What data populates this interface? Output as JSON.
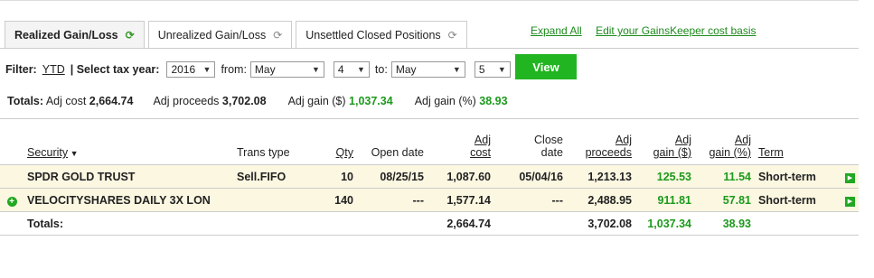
{
  "tabs": [
    {
      "label": "Realized Gain/Loss",
      "icon": "refresh-icon"
    },
    {
      "label": "Unrealized Gain/Loss",
      "icon": "refresh-icon"
    },
    {
      "label": "Unsettled Closed Positions",
      "icon": "refresh-icon"
    }
  ],
  "links": {
    "expand_all": "Expand All",
    "edit_cost_basis": "Edit your GainsKeeper cost basis"
  },
  "filter": {
    "label": "Filter:",
    "ytd": "YTD",
    "tax_year_label": "| Select tax year:",
    "tax_year": "2016",
    "from_label": "from:",
    "from_month": "May",
    "from_day": "4",
    "to_label": "to:",
    "to_month": "May",
    "to_day": "5",
    "view_button": "View"
  },
  "totals": {
    "label": "Totals:",
    "adj_cost_label": "Adj cost",
    "adj_cost": "2,664.74",
    "adj_proceeds_label": "Adj proceeds",
    "adj_proceeds": "3,702.08",
    "adj_gain_label": "Adj gain ($)",
    "adj_gain": "1,037.34",
    "adj_gain_pct_label": "Adj gain (%)",
    "adj_gain_pct": "38.93"
  },
  "table": {
    "headers": {
      "security": "Security",
      "trans_type": "Trans type",
      "qty": "Qty",
      "open_date": "Open date",
      "adj_cost_1": "Adj",
      "adj_cost_2": "cost",
      "close_date_1": "Close",
      "close_date_2": "date",
      "adj_proceeds_1": "Adj",
      "adj_proceeds_2": "proceeds",
      "adj_gain_1": "Adj",
      "adj_gain_2": "gain ($)",
      "adj_gain_pct_1": "Adj",
      "adj_gain_pct_2": "gain (%)",
      "term": "Term"
    },
    "rows": [
      {
        "security": "SPDR GOLD TRUST",
        "trans_type": "Sell.FIFO",
        "qty": "10",
        "open_date": "08/25/15",
        "adj_cost": "1,087.60",
        "close_date": "05/04/16",
        "adj_proceeds": "1,213.13",
        "adj_gain": "125.53",
        "adj_gain_pct": "11.54",
        "term": "Short-term"
      },
      {
        "security": "VELOCITYSHARES DAILY 3X LON",
        "trans_type": "",
        "qty": "140",
        "open_date": "---",
        "adj_cost": "1,577.14",
        "close_date": "---",
        "adj_proceeds": "2,488.95",
        "adj_gain": "911.81",
        "adj_gain_pct": "57.81",
        "term": "Short-term"
      }
    ],
    "totals_row": {
      "label": "Totals:",
      "adj_cost": "2,664.74",
      "adj_proceeds": "3,702.08",
      "adj_gain": "1,037.34",
      "adj_gain_pct": "38.93"
    }
  },
  "colors": {
    "accent_green": "#21b521",
    "gain_green": "#1c9a1c",
    "row_highlight": "#fbf7e1"
  }
}
